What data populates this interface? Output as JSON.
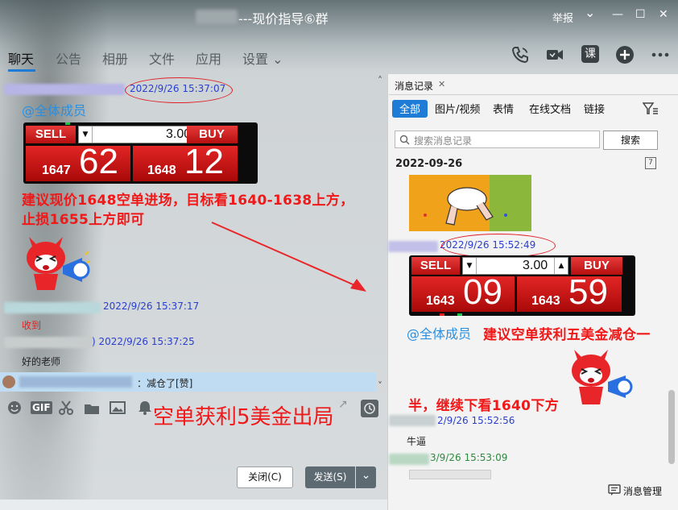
{
  "window": {
    "title": "---现价指导⑥群",
    "report_label": "举报",
    "min_glyph": "—",
    "max_glyph": "☐",
    "close_glyph": "✕",
    "dropdown_glyph": "⌄"
  },
  "tabs": [
    {
      "label": "聊天",
      "active": true
    },
    {
      "label": "公告"
    },
    {
      "label": "相册"
    },
    {
      "label": "文件"
    },
    {
      "label": "应用"
    },
    {
      "label": "设置 ⌄"
    }
  ],
  "header_icons": [
    "phone-icon",
    "video-icon",
    "class-icon",
    "add-icon",
    "more-icon"
  ],
  "class_icon_label": "课",
  "chat": {
    "messages": [
      {
        "time": "2022/9/26 15:37:07",
        "mention": "@全体成员",
        "widget": {
          "sell": "SELL",
          "buy": "BUY",
          "qty": "3.00",
          "sell_small": "1647",
          "sell_big": "62",
          "buy_small": "1648",
          "buy_big": "12"
        },
        "text_line1": "建议现价1648空单进场，目标看1640-1638上方，",
        "text_line2": "止损1655上方即可"
      },
      {
        "time": "2022/9/26 15:37:17",
        "text": "收到"
      },
      {
        "time": ") 2022/9/26 15:37:25",
        "text": "好的老师"
      }
    ],
    "notice": "：减仓了[赞]",
    "overlay_text": "空单获利5美金出局",
    "scroll_up": "˄",
    "scroll_down": "˅"
  },
  "toolbar_icons": [
    "emoji-icon",
    "gif-icon",
    "scissors-icon",
    "folder-icon",
    "image-icon",
    "bell-icon",
    "history-icon"
  ],
  "gif_label": "GIF",
  "buttons": {
    "close": "关闭(C)",
    "send": "发送(S)",
    "send_arrow": "⌄"
  },
  "history_panel": {
    "tab_label": "消息记录",
    "tab_close": "✕",
    "filters": [
      {
        "label": "全部",
        "active": true
      },
      {
        "label": "图片/视频"
      },
      {
        "label": "表情"
      },
      {
        "label": "在线文档"
      },
      {
        "label": "链接"
      }
    ],
    "search_placeholder": "搜索消息记录",
    "search_button": "搜索",
    "date": "2022-09-26",
    "calendar_day": "7",
    "time1": "2022/9/26 15:52:49",
    "widget": {
      "sell": "SELL",
      "buy": "BUY",
      "qty": "3.00",
      "sell_small": "1643",
      "sell_big": "09",
      "buy_small": "1643",
      "buy_big": "59"
    },
    "mention": "@全体成员",
    "text_a": "建议空单获利五美金减仓一",
    "text_b": "半，继续下看1640下方",
    "time2": "2/9/26 15:52:56",
    "msg2": "牛逼",
    "time3": "3/9/26 15:53:09",
    "footer": "消息管理"
  },
  "colors": {
    "accent": "#1e7bd6",
    "red_text": "#f01818",
    "timestamp": "#2a3fcf",
    "mention": "#2b8fe0"
  }
}
